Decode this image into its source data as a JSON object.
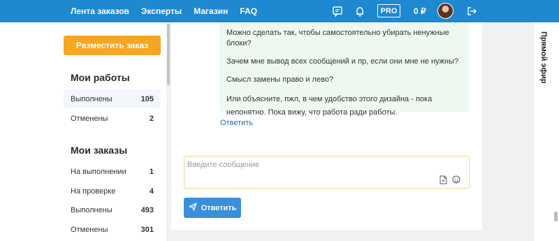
{
  "topnav": {
    "items": [
      "Лента заказов",
      "Эксперты",
      "Магазин",
      "FAQ"
    ],
    "pro_label": "PRO",
    "balance": "0 ₽"
  },
  "sidebar": {
    "order_button": "Разместить заказ",
    "works_title": "Мои работы",
    "works": [
      {
        "label": "Выполнены",
        "count": "105"
      },
      {
        "label": "Отменены",
        "count": "2"
      }
    ],
    "orders_title": "Мои заказы",
    "orders": [
      {
        "label": "На выполнении",
        "count": "1"
      },
      {
        "label": "На проверке",
        "count": "4"
      },
      {
        "label": "Выполнены",
        "count": "493"
      },
      {
        "label": "Отменены",
        "count": "301"
      }
    ]
  },
  "message": {
    "lines": [
      "Можно сделать так, чтобы самостоятельно убирать ненужные блоки?",
      "Зачем мне вывод всех сообщений и пр, если они мне не нужны?",
      "Смысл замены право и лево?",
      "Или объясните, пжл, в чем удобство этого дизайна - пока непонятно. Пока вижу, что работа ради работы."
    ],
    "reply_link": "Ответить"
  },
  "composer": {
    "placeholder": "Введите сообщение",
    "value": "",
    "send_label": "Ответить"
  },
  "live": {
    "label": "Прямой эфир"
  },
  "colors": {
    "topbar": "#1e88d0",
    "accent_orange": "#f5a623",
    "send_button": "#3b8ed8",
    "message_bg": "#eef8f1",
    "link": "#1e6bb0"
  },
  "icons": [
    "chat-icon",
    "bell-icon",
    "logout-icon",
    "file-attach-icon",
    "emoji-icon",
    "send-icon"
  ]
}
